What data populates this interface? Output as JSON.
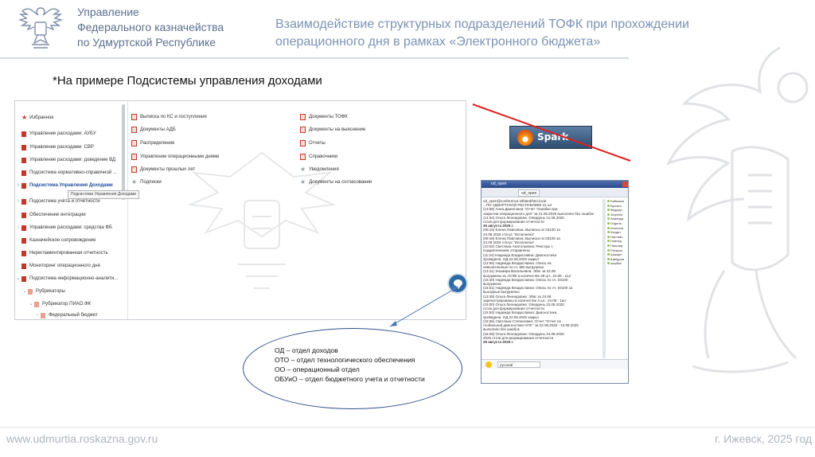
{
  "header": {
    "org_lines": [
      "Управление",
      "Федерального казначейства",
      "по Удмуртской Республике"
    ],
    "title_lines": [
      "Взаимодействие структурных подразделений ТОФК при прохождении",
      "операционного дня в рамках «Электронного бюджета»"
    ]
  },
  "subtitle": "*На примере Подсистемы управления доходами",
  "nav": {
    "items": [
      "Избранное",
      "Управление расходами: АУБУ",
      "Управление расходами: СВР",
      "Управление расходами: доведение ВД",
      "Подсистема нормативно-справочной ...",
      "Подсистема Управления Доходами",
      "Подсистема учёта и отчётности",
      "Обеспечение интеграции",
      "Управление расходами: средства ФБ",
      "Казначейское сопровождение",
      "Нерегламентированная отчетность",
      "Мониторинг операционного дня",
      "Подсистема информационно-аналити...",
      "Рубрикаторы",
      "Рубрикатор ПИАО.ФК",
      "Федеральный бюджет"
    ],
    "tooltip": "Подсистема Управления Доходами"
  },
  "middle_col": [
    "Выписка по КС и поступления",
    "Документы АДБ",
    "Распределение",
    "Управление операционными днями",
    "Документы прошлых лет",
    "Подписки"
  ],
  "right_col": [
    "Документы ТОФК",
    "Документы на выяснение",
    "Отчеты",
    "Справочники",
    "Уведомления",
    "Документы на согласовании"
  ],
  "spark": {
    "button_label": "Spark",
    "window_title": "od_open",
    "tab_label": "od_open",
    "lang_label": "русский",
    "log_lines": [
      {
        "t": "od_open@conference.inflated/htm.local",
        "b": false
      },
      {
        "t": "...ПО УДМУРТСКОЙ РЕСПУБЛИКЕ 21 шт",
        "b": false
      },
      {
        "t": "(13:58) Анна Даниловна: Отчет \"Ошибки при",
        "b": false
      },
      {
        "t": "закрытии операционного дня\" за 21.08.2025 выполнен без ошибок",
        "b": false
      },
      {
        "t": "(14:54) Ольга Леонидовна: Опердень 21.08.2025",
        "b": false
      },
      {
        "t": "готов для формирования отчетности",
        "b": false
      },
      {
        "t": "25 августа 2025 г.",
        "b": true
      },
      {
        "t": "(09:16) Елена Павловна: Выписка по 03100 за",
        "b": false
      },
      {
        "t": "24.08.2025 статус \"Исполнена\"",
        "b": false
      },
      {
        "t": "(09:49) Елена Павловна: Выписка по 03100 за",
        "b": false
      },
      {
        "t": "24.08.2025 статус \"Исполнена\"",
        "b": false
      },
      {
        "t": "(10:02) Светлана Анатольевна: Реестры с",
        "b": false
      },
      {
        "t": "подкреплением отправлены",
        "b": false
      },
      {
        "t": "(11:24) Надежда Владиславна: Диагностика",
        "b": false
      },
      {
        "t": "проведена. ОД 22.08.2025 закрыт",
        "b": false
      },
      {
        "t": "(12:56) Надежда Владиславна: Опись на",
        "b": false
      },
      {
        "t": "невыясненные по сч. МБ выгружена",
        "b": false
      },
      {
        "t": "(13:11) Эльмира Васильевна: Эбаг за 22.08",
        "b": false
      },
      {
        "t": "выгружены из АСФК в количестве 29 шт., 24.08 - 1шт",
        "b": false
      },
      {
        "t": "(15:40) Надежда Владиславна: Опись по сч. 03100",
        "b": false
      },
      {
        "t": "выгружена",
        "b": false
      },
      {
        "t": "(15:51) Надежда Владиславна: Опись по сч. 03100 за",
        "b": false
      },
      {
        "t": "выходные выгружены",
        "b": false
      },
      {
        "t": "(13:38) Ольга Леонидовна: Эбаг за 24.08",
        "b": false
      },
      {
        "t": "зарегистрированы в количестве 3 шт., 24.08 - 1шт",
        "b": false
      },
      {
        "t": "(15:00) Ольга Леонидовна: Опердень 22.08.2025",
        "b": false
      },
      {
        "t": "готов для формирования отчетности",
        "b": false
      },
      {
        "t": "(15:52) Надежда Владиславна: Диагностика",
        "b": false
      },
      {
        "t": "проведена. ОД 24.08.2025 закрыт",
        "b": false
      },
      {
        "t": "(15:56) Светлана Степановна: Отчет \"Отчет по",
        "b": false
      },
      {
        "t": "глобальной диагностике НПС\" за 22.08.2025 - 24.08.2025",
        "b": false
      },
      {
        "t": "выполнен без ошибок",
        "b": false
      },
      {
        "t": "(16:28) Ольга Леонидовна: Опердень 24.08.2025",
        "b": false
      },
      {
        "t": "2025 готов для формирования отчетности",
        "b": false
      },
      {
        "t": "26 августа 2025 г.",
        "b": true
      }
    ],
    "roster": [
      "Бабышки",
      "Бухгалт",
      "Ведущи",
      "Загреби",
      "Замхиди",
      "Отдели",
      "Исполни",
      "Кондит",
      "Наставн",
      "Новлед",
      "Пашлед",
      "Раскрол",
      "Шакиро",
      "Шмбурни",
      "ширйкн"
    ]
  },
  "legend": [
    "ОД – отдел доходов",
    "ОТО – отдел технологического обеспечения",
    "ОО – операционный отдел",
    "ОБУиО – отдел бюджетного учета и отчетности"
  ],
  "footer": {
    "site": "www.udmurtia.roskazna.gov.ru",
    "city": "г. Ижевск, 2025 год"
  },
  "colors": {
    "accent_blue": "#7b93b4",
    "red_line": "#e02020",
    "oval_border": "#2f4f8a"
  }
}
